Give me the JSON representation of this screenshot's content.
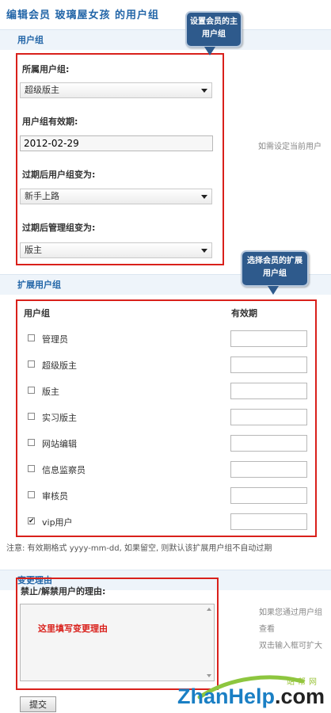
{
  "page_title": "编辑会员  玻璃屋女孩 的用户组",
  "sections": {
    "usergroup": "用户组",
    "extended": "扩展用户组",
    "reason": "变更理由"
  },
  "fields": {
    "group_label": "所属用户组:",
    "group_value": "超级版主",
    "expiry_label": "用户组有效期:",
    "expiry_value": "2012-02-29",
    "expiry_hint": "如需设定当前用户",
    "after_group_label": "过期后用户组变为:",
    "after_group_value": "新手上路",
    "after_admin_label": "过期后管理组变为:",
    "after_admin_value": "版主"
  },
  "callouts": {
    "main_group": "设置会员的主用户组",
    "ext_group": "选择会员的扩展用户组"
  },
  "ext_table": {
    "col_group": "用户组",
    "col_expiry": "有效期",
    "rows": [
      {
        "name": "管理员",
        "checked": false
      },
      {
        "name": "超级版主",
        "checked": false
      },
      {
        "name": "版主",
        "checked": false
      },
      {
        "name": "实习版主",
        "checked": false
      },
      {
        "name": "网站编辑",
        "checked": false
      },
      {
        "name": "信息监察员",
        "checked": false
      },
      {
        "name": "审核员",
        "checked": false
      },
      {
        "name": "vip用户",
        "checked": true
      }
    ]
  },
  "note": "注意: 有效期格式 yyyy-mm-dd, 如果留空, 则默认该扩展用户组不自动过期",
  "reason": {
    "label": "禁止/解禁用户的理由:",
    "placeholder": "这里填写变更理由",
    "hints": [
      "如果您通过用户组",
      "查看",
      "双击输入框可扩大"
    ]
  },
  "submit_label": "提交",
  "watermark": {
    "small": "站帮网",
    "brand": "ZhanHelp",
    "suffix": ".com"
  },
  "colors": {
    "accent_blue": "#2366a8",
    "highlight_red": "#d9201b",
    "callout_bg": "#2e5a8c",
    "section_bg": "#eef4fa"
  }
}
